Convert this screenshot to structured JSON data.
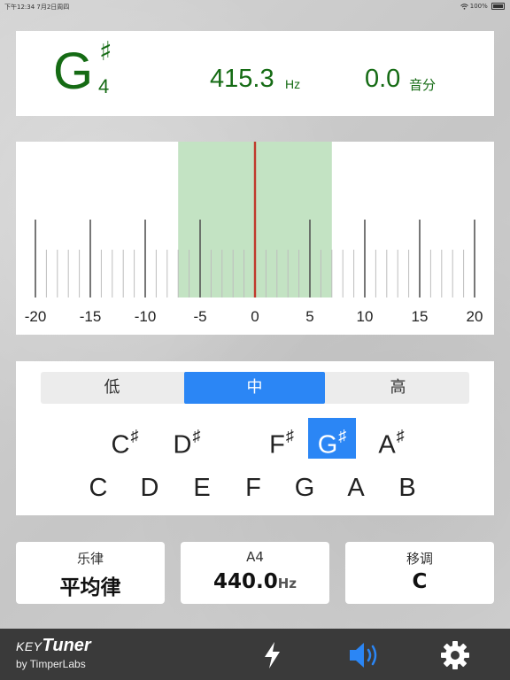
{
  "status_bar": {
    "time_date": "下午12:34   7月2日周四",
    "battery": "100%"
  },
  "reading": {
    "note": "G",
    "accidental": "♯",
    "octave": "4",
    "frequency": "415.3",
    "frequency_unit": "Hz",
    "cents": "0.0",
    "cents_unit": "音分"
  },
  "meter": {
    "scale_labels": [
      "-20",
      "-15",
      "-10",
      "-5",
      "0",
      "5",
      "10",
      "15",
      "20"
    ],
    "range": [
      -20,
      20
    ],
    "in_tune_zone": [
      -7,
      7
    ],
    "needle_value": 0,
    "colors": {
      "zone": "#c3e3c3",
      "needle": "#c0392b",
      "tick": "#555555"
    }
  },
  "octave_selector": {
    "options": [
      "低",
      "中",
      "高"
    ],
    "selected_index": 1
  },
  "keys": {
    "sharps": [
      {
        "letter": "C",
        "accidental": "♯"
      },
      {
        "letter": "D",
        "accidental": "♯"
      },
      {
        "letter": "F",
        "accidental": "♯"
      },
      {
        "letter": "G",
        "accidental": "♯"
      },
      {
        "letter": "A",
        "accidental": "♯"
      }
    ],
    "naturals": [
      "C",
      "D",
      "E",
      "F",
      "G",
      "A",
      "B"
    ],
    "selected": "G♯",
    "accent_color": "#2b86f5"
  },
  "cards": {
    "temperament": {
      "title": "乐律",
      "value": "平均律"
    },
    "a4": {
      "title": "A4",
      "value": "440.0",
      "unit": "Hz"
    },
    "transpose": {
      "title": "移调",
      "value": "C"
    }
  },
  "brand": {
    "key": "KEY",
    "tuner": "Tuner",
    "by": "by TimperLabs"
  },
  "tab_icons": [
    "lightning-icon",
    "speaker-icon",
    "gear-icon"
  ],
  "colors": {
    "reading_green": "#156b14",
    "tab_bar": "#3a3a3a",
    "speaker_active": "#2b86f5"
  }
}
